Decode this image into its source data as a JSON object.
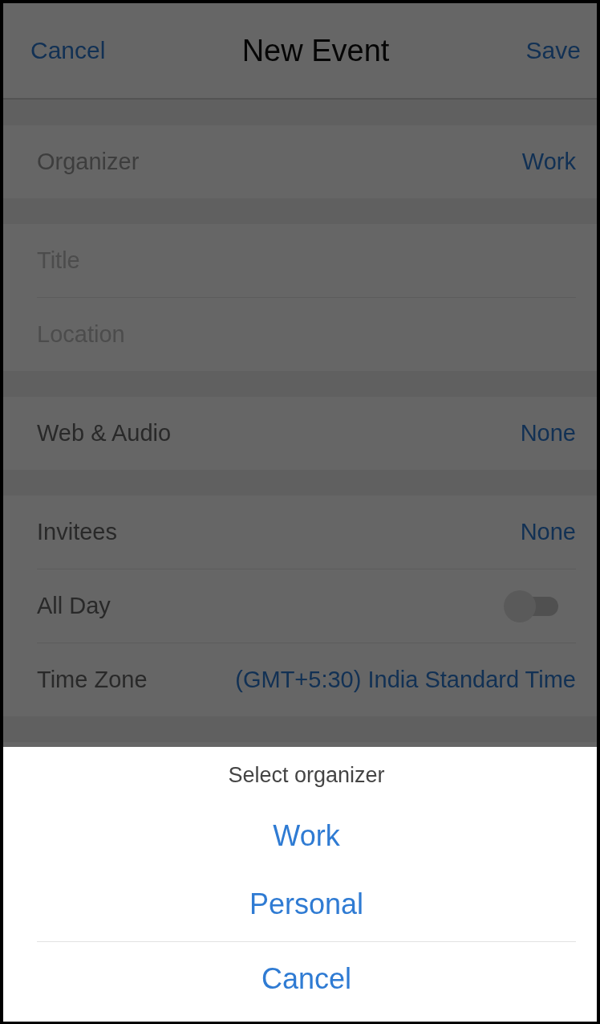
{
  "header": {
    "cancel": "Cancel",
    "title": "New Event",
    "save": "Save"
  },
  "sections": [
    {
      "rows": [
        {
          "kind": "value",
          "label": "Organizer",
          "value": "Work",
          "muted": true
        }
      ]
    },
    {
      "rows": [
        {
          "kind": "input",
          "placeholder": "Title"
        },
        {
          "kind": "input",
          "placeholder": "Location"
        }
      ]
    },
    {
      "rows": [
        {
          "kind": "value",
          "label": "Web & Audio",
          "value": "None",
          "muted": false
        }
      ]
    },
    {
      "rows": [
        {
          "kind": "value",
          "label": "Invitees",
          "value": "None",
          "muted": false
        },
        {
          "kind": "toggle",
          "label": "All Day",
          "on": false
        },
        {
          "kind": "value",
          "label": "Time Zone",
          "value": "(GMT+5:30) India Standard Time",
          "muted": false
        }
      ]
    }
  ],
  "sheet": {
    "title": "Select organizer",
    "options": [
      "Work",
      "Personal"
    ],
    "cancel": "Cancel"
  }
}
